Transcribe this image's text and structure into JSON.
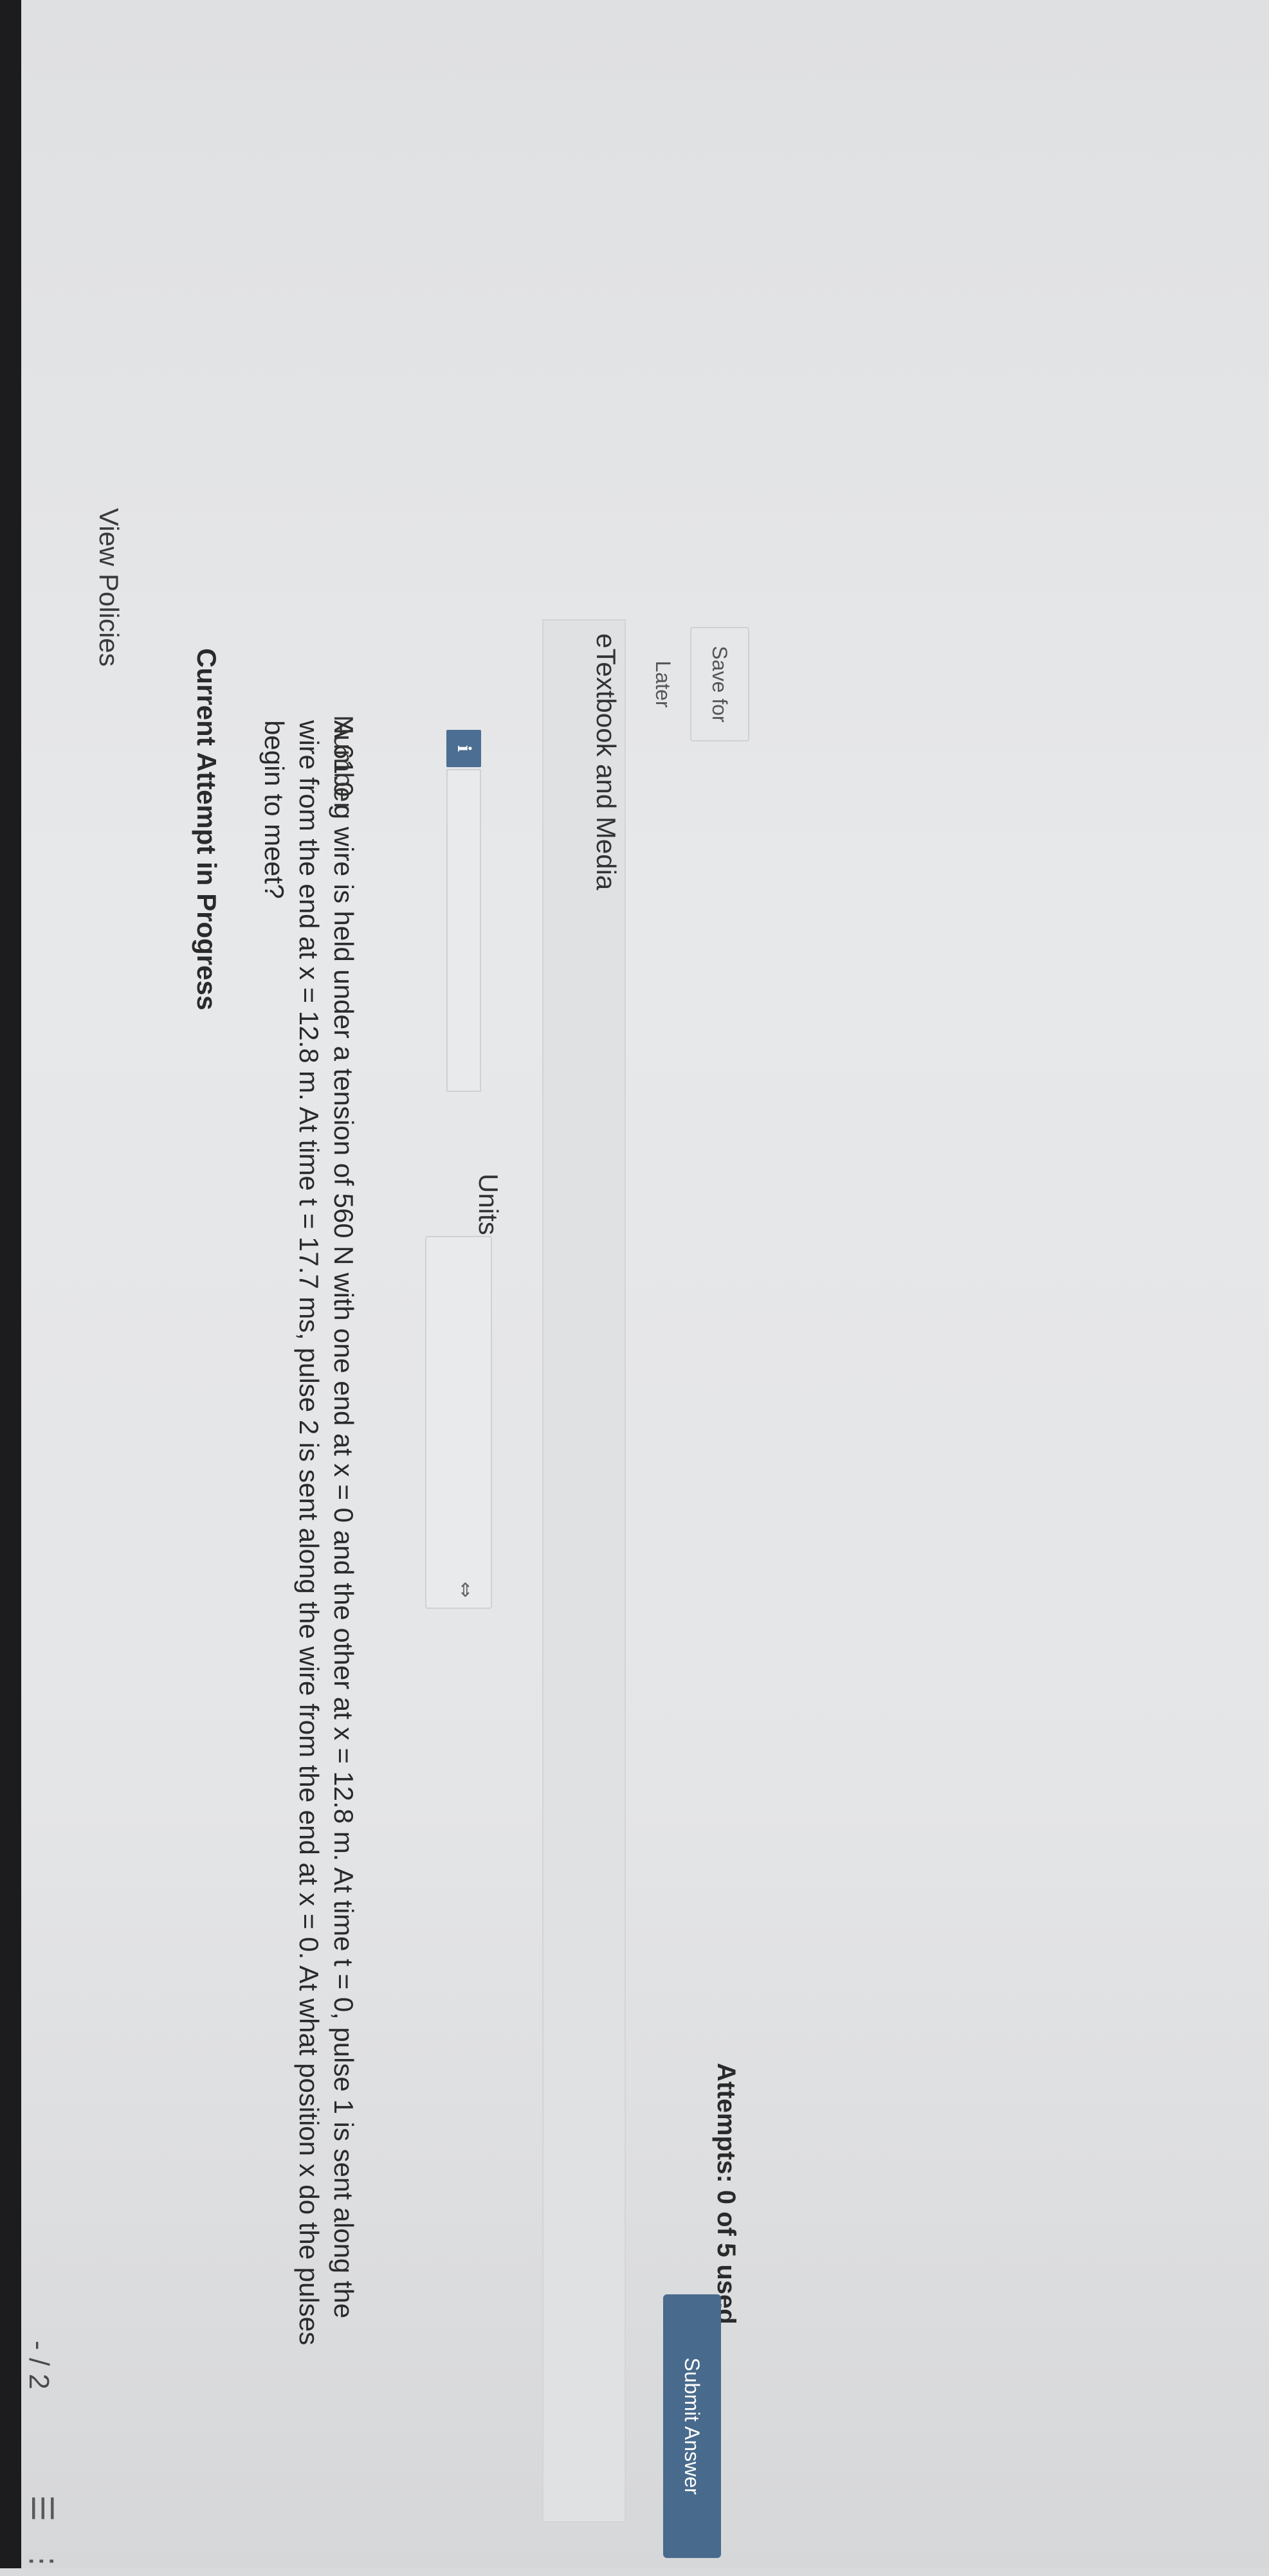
{
  "header": {
    "page_indicator": "- / 2",
    "list_icon": "list-icon",
    "more_icon": "more-vertical-icon"
  },
  "links": {
    "view_policies": "View Policies"
  },
  "attempt": {
    "heading": "Current Attempt in Progress",
    "question": "A 61.0 g wire is held under a tension of 560 N with one end at x = 0 and the other at x = 12.8 m. At time t = 0, pulse 1 is sent along the wire from the end at x = 12.8 m. At time t = 17.7 ms, pulse 2 is sent along the wire from the end at x = 0. At what position x do the pulses begin to meet?"
  },
  "answer": {
    "number_label": "Number",
    "info_glyph": "i",
    "number_value": "",
    "units_label": "Units",
    "units_selected": ""
  },
  "etextbook": {
    "label": "eTextbook and Media"
  },
  "actions": {
    "save_label": "Save for Later",
    "attempts_text": "Attempts: 0 of 5 used",
    "submit_label": "Submit Answer"
  },
  "colors": {
    "accent": "#486a8c",
    "info_icon_bg": "#4b6e92"
  }
}
